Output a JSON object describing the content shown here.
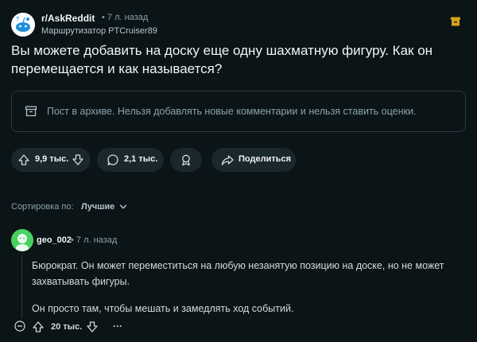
{
  "post": {
    "subreddit": "r/AskReddit",
    "time": "• 7 л. назад",
    "author": "Маршрутизатор PTCruiser89",
    "title": "Вы можете добавить на доску еще одну шахматную фигуру. Как он перемещается и как называется?",
    "archive_notice": "Пост в архиве. Нельзя добавлять новые комментарии и нельзя ставить оценки.",
    "votes": "9,9 тыс.",
    "comments": "2,1 тыс.",
    "share_label": "Поделиться"
  },
  "sort": {
    "label": "Сортировка по:",
    "value": "Лучшие"
  },
  "comment": {
    "author": "geo_002",
    "time": "• 7 л. назад",
    "paragraph1": "Бюрократ. Он может переместиться на любую незанятую позицию на доске, но не может захватывать фигуры.",
    "paragraph2": "Он просто там, чтобы мешать и замедлять ход событий.",
    "votes": "20 тыс.",
    "more": "···"
  },
  "colors": {
    "background": "#0b1416",
    "pill": "#1a282d",
    "accent_archive": "#d6a21e",
    "muted": "#8ba2ad"
  }
}
